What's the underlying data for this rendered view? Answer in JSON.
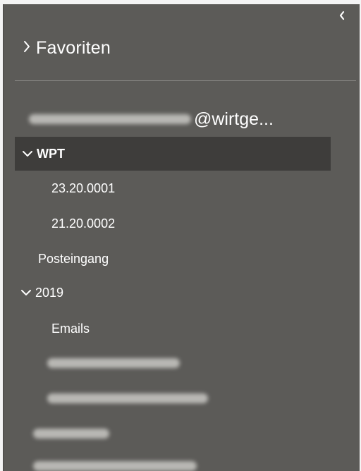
{
  "navigation_pane": {
    "collapse_icon": "chevron-left-icon",
    "favorites": {
      "label": "Favoriten",
      "icon": "chevron-right-icon"
    },
    "account": {
      "email_visible_part": "@wirtge..."
    },
    "folders": [
      {
        "label": "WPT",
        "expanded": true,
        "selected": true,
        "icon": "chevron-down-icon"
      },
      {
        "label": "23.20.0001"
      },
      {
        "label": "21.20.0002"
      },
      {
        "label": "Posteingang"
      },
      {
        "label": "2019",
        "expanded": true,
        "icon": "chevron-down-icon"
      },
      {
        "label": "Emails"
      }
    ]
  }
}
